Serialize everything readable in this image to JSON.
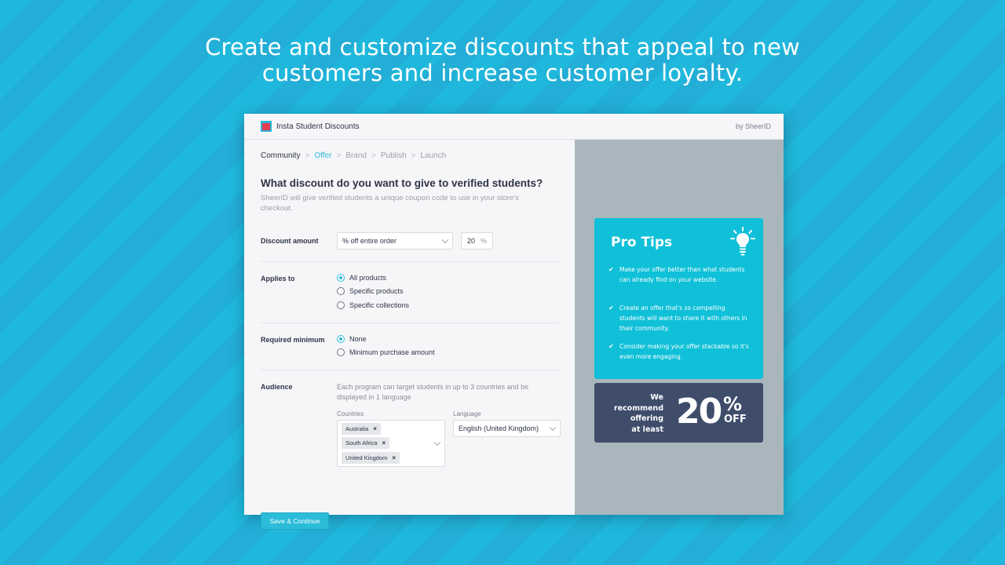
{
  "headline": {
    "line1": "Create and customize discounts that appeal to new",
    "line2": "customers and increase customer loyalty."
  },
  "app": {
    "title": "Insta Student Discounts",
    "by": "by SheerID",
    "logo_icon": "sheerid-logo-icon"
  },
  "breadcrumb": [
    {
      "label": "Community",
      "state": "done"
    },
    {
      "label": "Offer",
      "state": "active"
    },
    {
      "label": "Brand",
      "state": "upcoming"
    },
    {
      "label": "Publish",
      "state": "upcoming"
    },
    {
      "label": "Launch",
      "state": "upcoming"
    }
  ],
  "breadcrumb_sep": ">",
  "form": {
    "title": "What discount do you want to give to verified students?",
    "subtitle": "SheerID will give verified students a unique coupon code to use in your store's checkout.",
    "discount": {
      "label": "Discount amount",
      "type_value": "% off entire order",
      "amount_value": "20",
      "amount_unit": "%"
    },
    "applies_to": {
      "label": "Applies to",
      "options": [
        "All products",
        "Specific products",
        "Specific collections"
      ],
      "selected": 0
    },
    "required_minimum": {
      "label": "Required minimum",
      "options": [
        "None",
        "Minimum purchase amount"
      ],
      "selected": 0
    },
    "audience": {
      "label": "Audience",
      "description": "Each program can target students in up to 3 countries and be displayed in 1 language",
      "countries_label": "Countries",
      "countries": [
        "Australia",
        "South Africa",
        "United Kingdom"
      ],
      "remove_glyph": "×",
      "language_label": "Language",
      "language_value": "English (United Kingdom)"
    },
    "save_label": "Save & Continue"
  },
  "tips": {
    "title": "Pro Tips",
    "icon": "lightbulb-icon",
    "check": "✔",
    "items": [
      "Make your offer better than what students can already find on your website.",
      "Create an offer that's so compelling students will want to share it with others in their community.",
      "Consider making your offer stackable so it's even more engaging."
    ]
  },
  "recommend": {
    "lines": [
      "We",
      "recommend",
      "offering",
      "at least"
    ],
    "value": "20",
    "percent": "%",
    "suffix": "OFF"
  },
  "colors": {
    "accent": "#2bb8d8",
    "tips_bg": "#0fc0d8",
    "recommend_bg": "#3f4d6b",
    "background": "#1fb8dc"
  }
}
